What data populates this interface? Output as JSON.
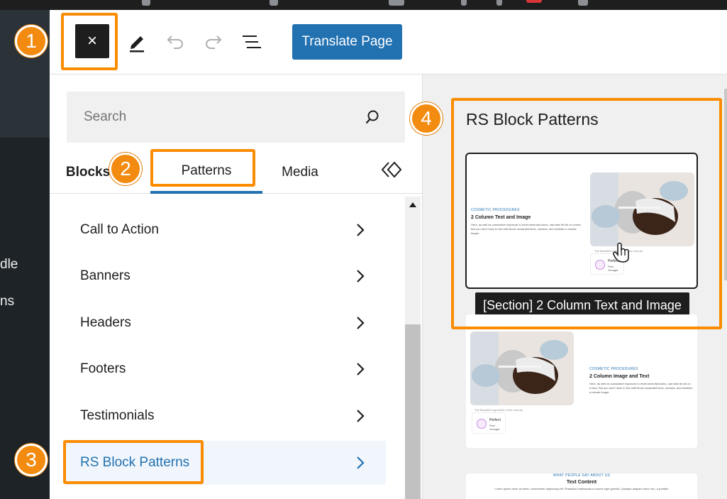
{
  "sidebar_fragments": [
    "dle",
    "ns"
  ],
  "toolbar": {
    "close_label": "×",
    "translate_label": "Translate Page"
  },
  "search": {
    "placeholder": "Search"
  },
  "tabs": {
    "blocks": "Blocks",
    "patterns": "Patterns",
    "media": "Media"
  },
  "categories": [
    "Call to Action",
    "Banners",
    "Headers",
    "Footers",
    "Testimonials",
    "RS Block Patterns"
  ],
  "preview": {
    "title": "RS Block Patterns",
    "tooltip": "[Section] 2 Column Text and Image",
    "card1": {
      "eyebrow": "COSMETIC PROCEDURES",
      "heading": "2 Column Text and Image",
      "body": "Here, as well as cumulative exposure to environmental toxins, can take its toll on a face. But you don't have to live with those unwanted lines, creases, and wrinkles a minute longer.",
      "caption": "The Beautiful ingredient of the formula",
      "badge_title": "Perfect",
      "badge_sub": "Feel Younger"
    },
    "card2": {
      "eyebrow": "COSMETIC PROCEDURES",
      "heading": "2 Column Image and Text",
      "body": "Here, as well as cumulative exposure to environmental toxins, can take its toll on a face. But you don't have to live with those unwanted lines, creases, and wrinkles a minute longer.",
      "caption": "The Beautiful ingredient of the formula",
      "badge_title": "Perfect",
      "badge_sub": "Feel Younger"
    },
    "card3": {
      "eyebrow": "WHAT PEOPLE SAY ABOUT US",
      "heading": "Text Content",
      "body": "Lorem ipsum dolor sit amet, consectetur adipiscing elit. Phasellus malesuada a mauris eget gravida. Quisque aliquam dolor non, a porttitor"
    }
  },
  "annotations": [
    "1",
    "2",
    "3",
    "4"
  ],
  "colors": {
    "accent": "#2271b1",
    "annotation": "#fb8c00",
    "dark": "#1e1e1e"
  }
}
